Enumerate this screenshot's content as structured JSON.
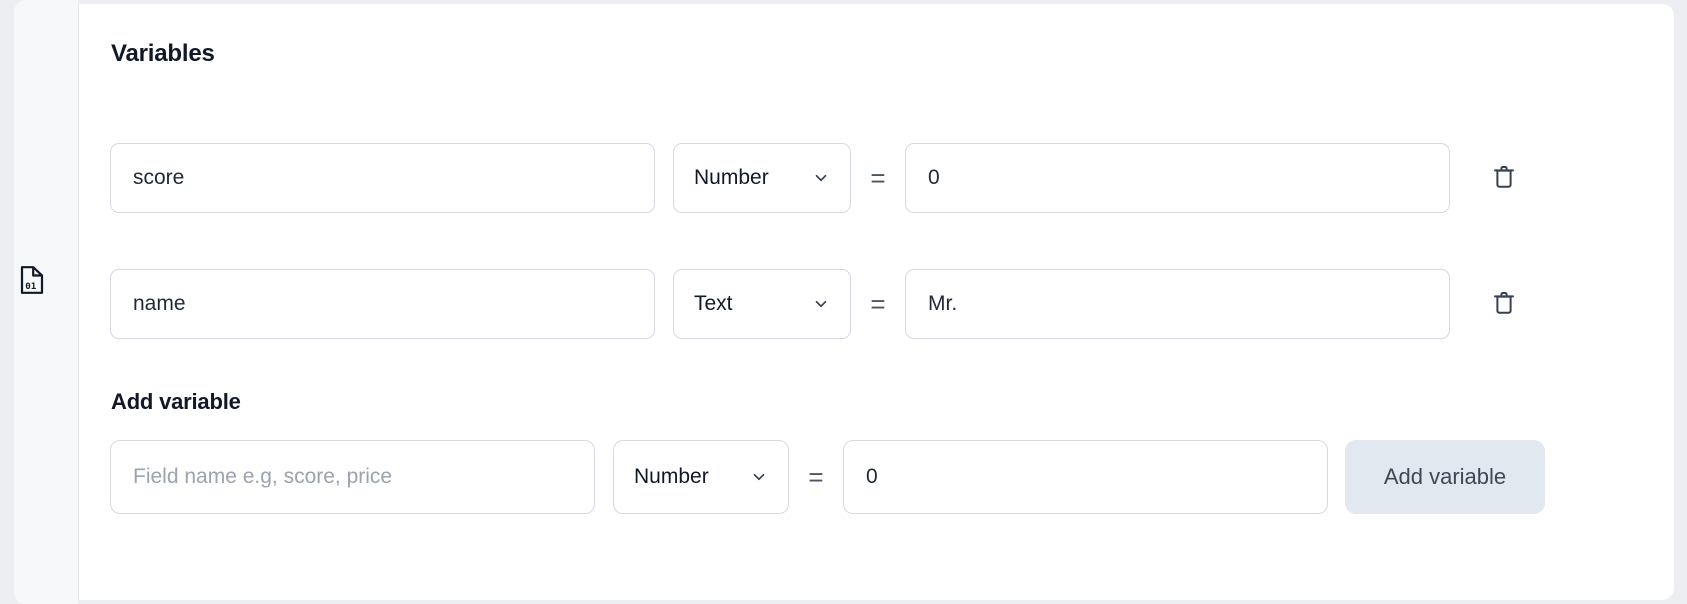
{
  "sidebar": {
    "icon": "file-binary-icon",
    "icon_label": "01"
  },
  "panel": {
    "section_title": "Variables",
    "add_section_title": "Add variable",
    "equals_symbol": "=",
    "delete_icon": "trash-icon",
    "chevron_icon": "chevron-down-icon"
  },
  "variables": [
    {
      "name": "score",
      "type": "Number",
      "value": "0",
      "delete_label": "Delete variable"
    },
    {
      "name": "name",
      "type": "Text",
      "value": "Mr.",
      "delete_label": "Delete variable"
    }
  ],
  "add_variable": {
    "name_value": "",
    "name_placeholder": "Field name e.g, score, price",
    "type": "Number",
    "value": "0",
    "button_label": "Add variable"
  },
  "type_options": [
    "Number",
    "Text"
  ],
  "colors": {
    "page_background": "#eceef1",
    "panel_background": "#ffffff",
    "rail_background": "#f7f8fa",
    "field_border": "#d6dae0",
    "text_primary": "#111827",
    "text_placeholder": "#9aa3ae",
    "button_background": "#e2e8f0",
    "button_text": "#3f4754",
    "icon_color": "#374151"
  }
}
